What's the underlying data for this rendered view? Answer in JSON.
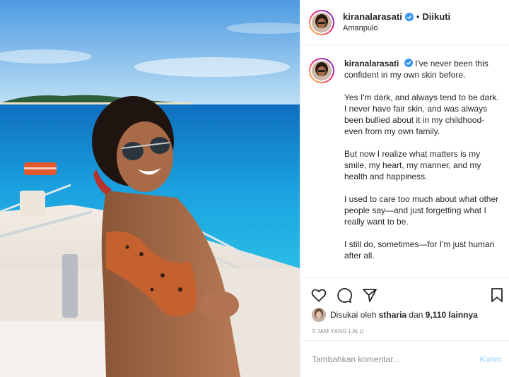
{
  "post": {
    "username": "kiranalarasati",
    "follow_label": "Diikuti",
    "separator": "•",
    "location": "Amanpulo",
    "caption_paragraphs": [
      "I've never been this confident in my own skin before.",
      "Yes I'm dark, and always tend to be dark. I never have fair skin, and was always been bullied about it in my childhood-even from my own family.",
      "But now I realize what matters is my smile, my heart, my manner, and my health and happiness.",
      "I used to care too much about what other people say—and just forgetting what I really want to be.",
      "I still do, sometimes—for I'm just human after all."
    ]
  },
  "likes": {
    "prefix": "Disukai oleh",
    "liker": "stharia",
    "middle": "dan",
    "count": "9,110 lainnya"
  },
  "timestamp": "3 JAM YANG LALU",
  "comment": {
    "placeholder": "Tambahkan komentar...",
    "submit_label": "Kirim"
  },
  "icons": {
    "like": "heart-icon",
    "comment": "comment-icon",
    "share": "share-icon",
    "save": "bookmark-icon",
    "verified": "verified-badge-icon"
  },
  "colors": {
    "verified": "#3897f0",
    "text": "#262626",
    "muted": "#8e8e8e",
    "post_disabled": "#b2dffc"
  }
}
